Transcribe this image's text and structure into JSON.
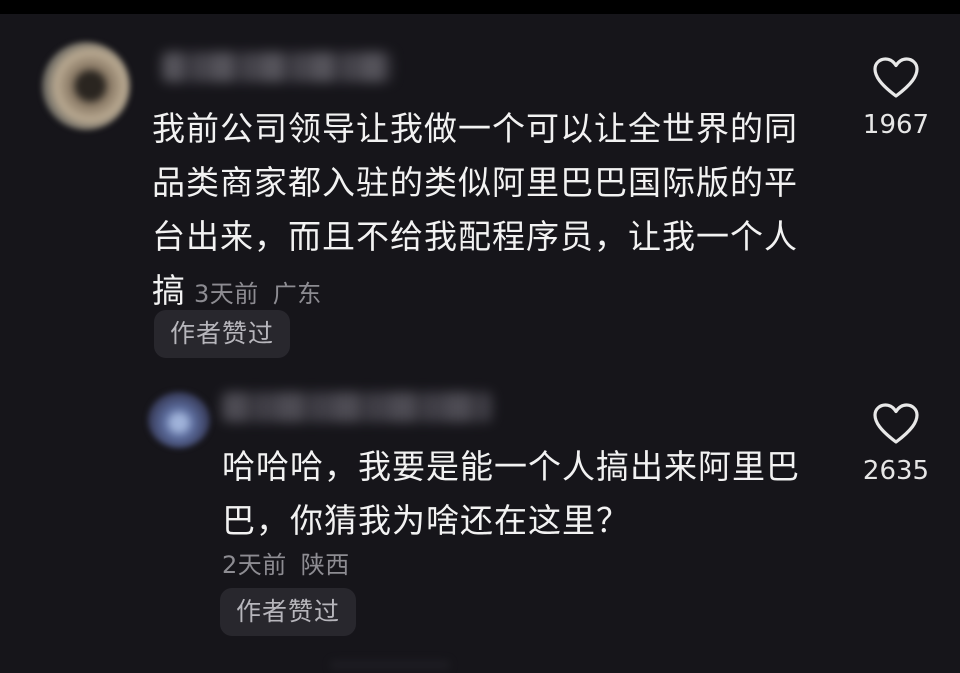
{
  "comments": [
    {
      "text": "我前公司领导让我做一个可以让全世界的同品类商家都入驻的类似阿里巴巴国际版的平台出来，而且不给我配程序员，让我一个人搞",
      "time": "3天前",
      "location": "广东",
      "author_liked": "作者赞过",
      "likes": "1967"
    },
    {
      "text": "哈哈哈，我要是能一个人搞出来阿里巴巴，你猜我为啥还在这里？",
      "time": "2天前",
      "location": "陕西",
      "author_liked": "作者赞过",
      "likes": "2635"
    }
  ],
  "icons": {
    "like": "heart-outline-icon"
  },
  "colors": {
    "background": "#16151a",
    "text": "#f2f2f2",
    "meta": "#8d8c92",
    "pill_bg": "#28272d"
  }
}
